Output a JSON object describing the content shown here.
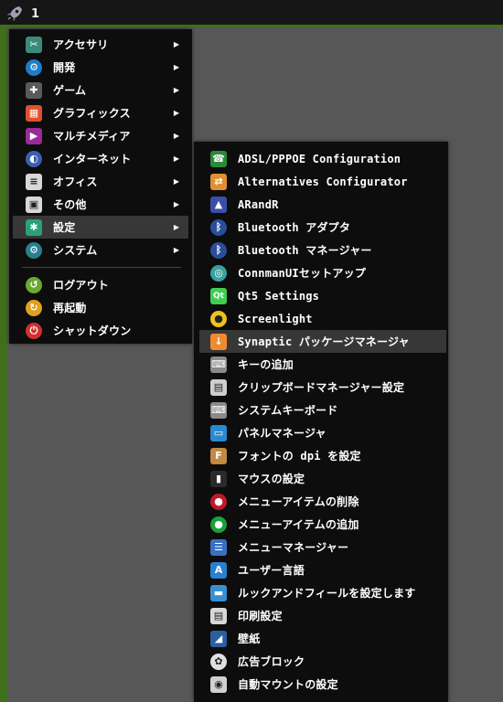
{
  "panel": {
    "desktop_number": "1"
  },
  "main_menu": {
    "items": [
      {
        "label": "アクセサリ",
        "icon": "accessories-icon",
        "color": "#3a8a7a",
        "has_submenu": true
      },
      {
        "label": "開発",
        "icon": "development-gear-icon",
        "color": "#1e7bc8",
        "has_submenu": true
      },
      {
        "label": "ゲーム",
        "icon": "gamepad-icon",
        "color": "#5a5a5a",
        "has_submenu": true
      },
      {
        "label": "グラフィックス",
        "icon": "graphics-palette-icon",
        "color": "#e0502a",
        "has_submenu": true
      },
      {
        "label": "マルチメディア",
        "icon": "multimedia-play-icon",
        "color": "#9a2a9a",
        "has_submenu": true
      },
      {
        "label": "インターネット",
        "icon": "internet-globe-icon",
        "color": "#3a5fb0",
        "has_submenu": true
      },
      {
        "label": "オフィス",
        "icon": "office-document-icon",
        "color": "#d8d8d8",
        "has_submenu": true
      },
      {
        "label": "その他",
        "icon": "other-toolbox-icon",
        "color": "#d8d8d8",
        "has_submenu": true
      },
      {
        "label": "設定",
        "icon": "settings-wrench-icon",
        "color": "#2aa07a",
        "has_submenu": true,
        "selected": true
      },
      {
        "label": "システム",
        "icon": "system-gear-icon",
        "color": "#2a7f8f",
        "has_submenu": true
      }
    ],
    "session_items": [
      {
        "label": "ログアウト",
        "icon": "logout-icon",
        "color": "#6aa830"
      },
      {
        "label": "再起動",
        "icon": "reboot-icon",
        "color": "#e0a020"
      },
      {
        "label": "シャットダウン",
        "icon": "shutdown-icon",
        "color": "#d03030"
      }
    ]
  },
  "settings_menu": {
    "items": [
      {
        "label": "ADSL/PPPOE Configuration",
        "icon": "adsl-phone-icon",
        "color": "#2a8a3a"
      },
      {
        "label": "Alternatives Configurator",
        "icon": "alternatives-icon",
        "color": "#e09030"
      },
      {
        "label": "ARandR",
        "icon": "arandr-wizard-icon",
        "color": "#3a4fa8"
      },
      {
        "label": "Bluetooth アダプタ",
        "icon": "bluetooth-icon",
        "color": "#2a4f9a"
      },
      {
        "label": "Bluetooth マネージャー",
        "icon": "bluetooth-icon",
        "color": "#2a4f9a"
      },
      {
        "label": "ConnmanUIセットアップ",
        "icon": "connman-icon",
        "color": "#3aa0a0"
      },
      {
        "label": "Qt5 Settings",
        "icon": "qt-icon",
        "color": "#41cd52"
      },
      {
        "label": "Screenlight",
        "icon": "lightbulb-icon",
        "color": "#f0c020"
      },
      {
        "label": "Synaptic パッケージマネージャ",
        "icon": "synaptic-download-icon",
        "color": "#f08a30",
        "selected": true
      },
      {
        "label": "キーの追加",
        "icon": "keyboard-icon",
        "color": "#8a8a8a"
      },
      {
        "label": "クリップボードマネージャー設定",
        "icon": "clipboard-icon",
        "color": "#cfcfcf"
      },
      {
        "label": "システムキーボード",
        "icon": "keyboard-icon",
        "color": "#8a8a8a"
      },
      {
        "label": "パネルマネージャ",
        "icon": "panel-icon",
        "color": "#2a8ad0"
      },
      {
        "label": "フォントの dpi を設定",
        "icon": "font-icon",
        "color": "#c08a40"
      },
      {
        "label": "マウスの設定",
        "icon": "mouse-icon",
        "color": "#2a2a2a"
      },
      {
        "label": "メニューアイテムの削除",
        "icon": "menu-remove-icon",
        "color": "#c01a2a"
      },
      {
        "label": "メニューアイテムの追加",
        "icon": "menu-add-icon",
        "color": "#1aa03a"
      },
      {
        "label": "メニューマネージャー",
        "icon": "menu-manager-icon",
        "color": "#3a6fc0"
      },
      {
        "label": "ユーザー言語",
        "icon": "user-language-icon",
        "color": "#2a7fd0"
      },
      {
        "label": "ルックアンドフィールを設定します",
        "icon": "look-and-feel-icon",
        "color": "#3a8fd0"
      },
      {
        "label": "印刷設定",
        "icon": "printer-icon",
        "color": "#d8d8d8"
      },
      {
        "label": "壁紙",
        "icon": "wallpaper-icon",
        "color": "#2a5fa0"
      },
      {
        "label": "広告ブロック",
        "icon": "adblock-icon",
        "color": "#e0e0e0"
      },
      {
        "label": "自動マウントの設定",
        "icon": "automount-icon",
        "color": "#d0d0d0"
      }
    ]
  }
}
